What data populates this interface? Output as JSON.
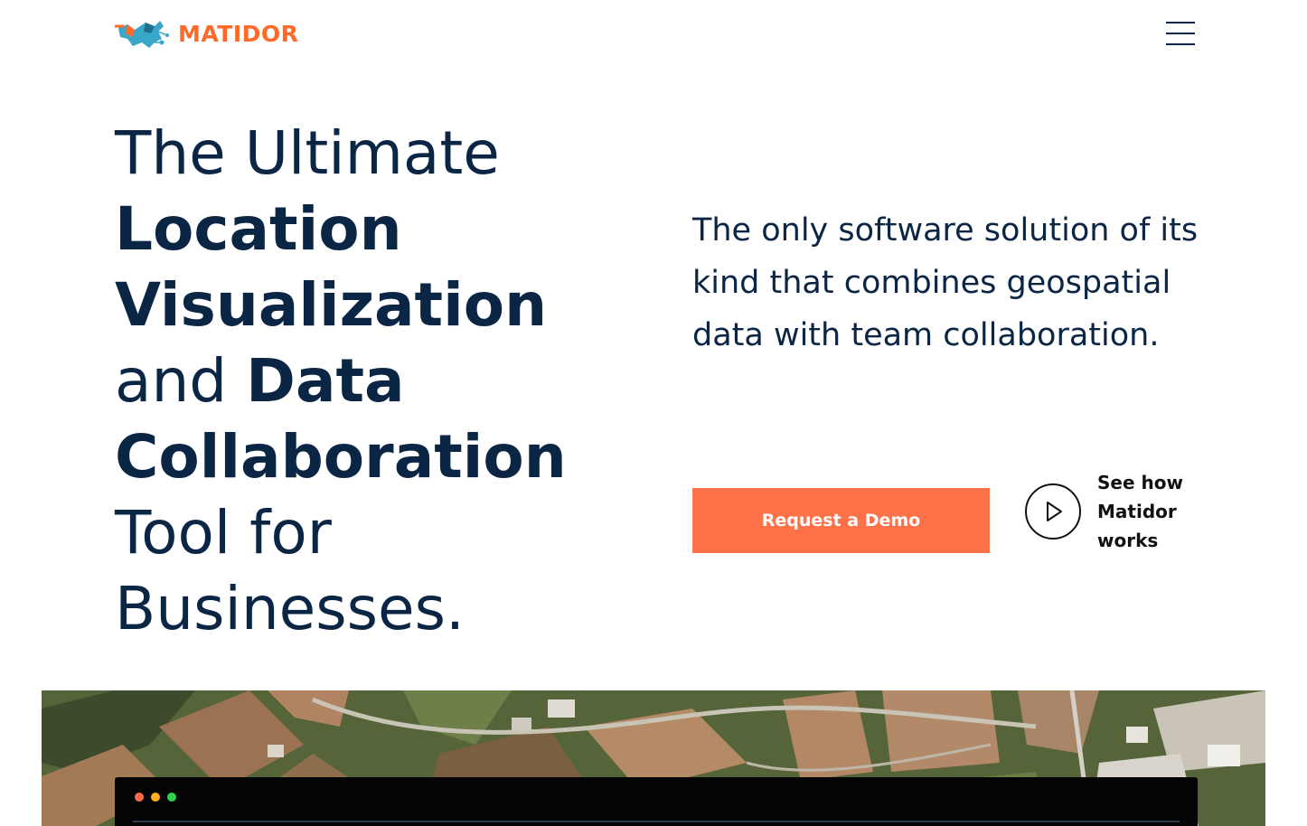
{
  "header": {
    "brand": "MATIDOR",
    "brand_color": "#ff6a2b",
    "menu_icon": "hamburger-menu-icon"
  },
  "hero": {
    "headline": {
      "line1": "The Ultimate",
      "line2": "Location",
      "line3": "Visualization",
      "line4_regular": "and ",
      "line4_bold": "Data",
      "line5": "Collaboration",
      "line6": "Tool for",
      "line7": "Businesses."
    },
    "tagline": "The only software solution of its kind that combines geospatial data with team collaboration.",
    "cta_label": "Request a Demo",
    "cta_color": "#ff7148",
    "video_link": {
      "line1": "See how",
      "line2": "Matidor",
      "line3": "works",
      "icon": "play-icon"
    }
  },
  "app_preview": {
    "window_dots": [
      "#ff6b4a",
      "#ffb020",
      "#2fcf4f"
    ]
  },
  "colors": {
    "text_primary": "#0b2545",
    "background": "#ffffff"
  }
}
